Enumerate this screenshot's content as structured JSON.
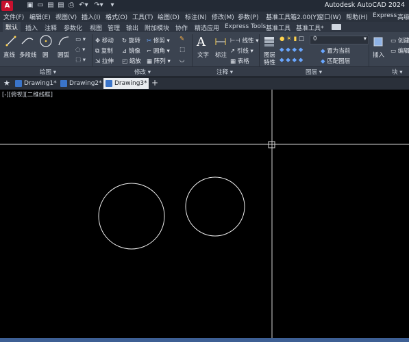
{
  "app": {
    "logo_letter": "A",
    "title": "Autodesk AutoCAD 2024"
  },
  "quick_access": [
    "new-icon",
    "open-icon",
    "save-icon",
    "saveas-icon",
    "plot-icon",
    "undo-icon",
    "redo-icon",
    "customize-icon"
  ],
  "menu": [
    "文件(F)",
    "编辑(E)",
    "视图(V)",
    "插入(I)",
    "格式(O)",
    "工具(T)",
    "绘图(D)",
    "标注(N)",
    "修改(M)",
    "参数(P)",
    "基准工具箱2.00(Y)",
    "窗口(W)",
    "帮助(H)",
    "Express",
    "高级"
  ],
  "ribbon_tabs": [
    "默认",
    "插入",
    "注释",
    "参数化",
    "视图",
    "管理",
    "输出",
    "附加模块",
    "协作",
    "精选应用",
    "Express Tools",
    "基准工具",
    "基准工具*"
  ],
  "ribbon": {
    "draw": {
      "line": "直线",
      "polyline": "多段线",
      "circle": "圆",
      "arc": "圆弧",
      "label": "绘图"
    },
    "modify": {
      "move": "移动",
      "rotate": "旋转",
      "trim": "修剪",
      "copy": "复制",
      "mirror": "镜像",
      "fillet": "圆角",
      "stretch": "拉伸",
      "scale": "缩放",
      "array": "阵列",
      "label": "修改"
    },
    "annotation": {
      "text": "文字",
      "dimension": "标注",
      "linear": "线性",
      "leader": "引线",
      "table": "表格",
      "label": "注释"
    },
    "layers": {
      "layer_props_line1": "图层",
      "layer_props_line2": "特性",
      "current_layer": "0",
      "make_current": "置为当前",
      "match_layer": "匹配图层",
      "label": "图层"
    },
    "block": {
      "insert": "插入",
      "create": "创建",
      "edit": "编辑",
      "label": "块"
    }
  },
  "file_tabs": [
    {
      "label": "Drawing1*"
    },
    {
      "label": "Drawing2*"
    },
    {
      "label": "Drawing3*",
      "active": true
    }
  ],
  "viewport_label": "[-][俯视][二维线框]",
  "colors": {
    "accent": "#c8102e",
    "background": "#000000",
    "ribbon": "#3b4350",
    "status": "#3d5f94"
  }
}
